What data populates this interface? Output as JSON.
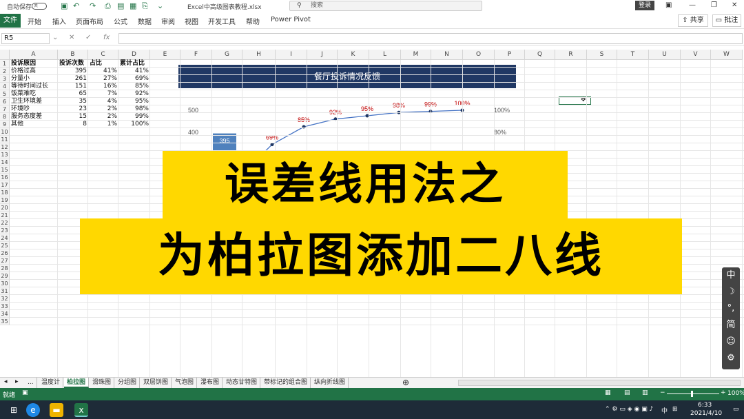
{
  "titlebar": {
    "autosave_label": "自动保存",
    "toggle_label": "关",
    "filename": "Excel中高级图表教程.xlsx",
    "search_placeholder": "搜索",
    "login_label": "登录"
  },
  "ribbon": {
    "file_label": "文件",
    "tabs": [
      "开始",
      "插入",
      "页面布局",
      "公式",
      "数据",
      "审阅",
      "视图",
      "开发工具",
      "帮助",
      "Power Pivot"
    ],
    "share_label": "共享",
    "comment_label": "批注"
  },
  "formula_bar": {
    "name_box": "R5",
    "fx": "fx"
  },
  "columns": [
    "A",
    "B",
    "C",
    "D",
    "E",
    "F",
    "G",
    "H",
    "I",
    "J",
    "K",
    "L",
    "M",
    "N",
    "O",
    "P",
    "Q",
    "R",
    "S",
    "T",
    "U",
    "V",
    "W"
  ],
  "rows": [
    "1",
    "2",
    "3",
    "4",
    "5",
    "6",
    "7",
    "8",
    "9",
    "10",
    "11",
    "12",
    "13",
    "14",
    "15",
    "16",
    "17",
    "18",
    "19",
    "20",
    "21",
    "22",
    "23",
    "24",
    "25",
    "26",
    "27",
    "28",
    "29",
    "30",
    "31",
    "32",
    "33",
    "34",
    "35"
  ],
  "table": {
    "headers": [
      "投诉原因",
      "投诉次数",
      "占比",
      "累计占比"
    ],
    "rows": [
      [
        "价格过高",
        "395",
        "41%",
        "41%"
      ],
      [
        "分量小",
        "261",
        "27%",
        "69%"
      ],
      [
        "等待时间过长",
        "151",
        "16%",
        "85%"
      ],
      [
        "饭菜难吃",
        "65",
        "7%",
        "92%"
      ],
      [
        "卫生环境差",
        "35",
        "4%",
        "95%"
      ],
      [
        "环境吵",
        "23",
        "2%",
        "98%"
      ],
      [
        "服务态度差",
        "15",
        "2%",
        "99%"
      ],
      [
        "其他",
        "8",
        "1%",
        "100%"
      ]
    ]
  },
  "chart_data": {
    "type": "bar",
    "title": "餐厅投诉情况反馈",
    "left_ticks": [
      "500",
      "400"
    ],
    "right_ticks": [
      "100%",
      "80%"
    ],
    "ylim": [
      0,
      500
    ],
    "ylim_right": [
      0,
      1
    ],
    "series": [
      {
        "values": [
          395,
          261,
          151,
          65,
          35,
          23,
          15,
          8
        ]
      },
      {
        "type": "line",
        "values": [
          0.41,
          0.69,
          0.85,
          0.92,
          0.95,
          0.98,
          0.99,
          1.0
        ]
      }
    ],
    "point_labels": [
      "69%",
      "85%",
      "92%",
      "95%",
      "98%",
      "99%",
      "100%"
    ],
    "bar_label": "395",
    "line_color": "#4472c4",
    "bar_color": "#4f81bd",
    "label_color": "#c00000"
  },
  "banner": {
    "line1": "误差线用法之",
    "line2": "为柏拉图添加二八线"
  },
  "ime_toolbar": [
    "中",
    "☽",
    "°,",
    "简",
    "☺",
    "⚙"
  ],
  "sheets": [
    "...",
    "温度计",
    "柏拉图",
    "滑珠图",
    "分组图",
    "双层饼图",
    "气泡图",
    "瀑布图",
    "动态甘特图",
    "带标记的组合图",
    "纵向折线图"
  ],
  "active_sheet": "柏拉图",
  "status": {
    "ready": "就绪",
    "zoom": "100%"
  },
  "taskbar": {
    "time": "6:33",
    "date": "2021/4/10",
    "lang": "中"
  }
}
